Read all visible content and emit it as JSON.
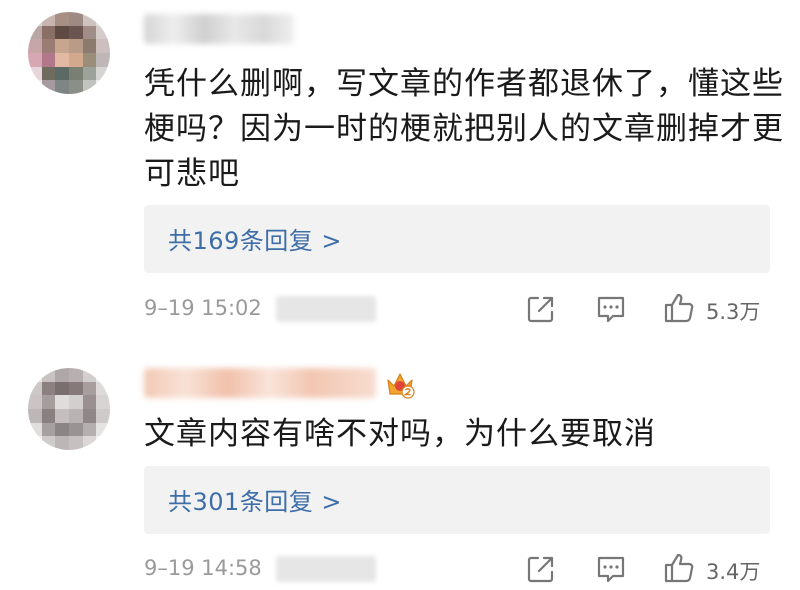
{
  "comments": [
    {
      "text_lines": [
        "凭什么删啊，写文章的作者都退休了，懂这些",
        "梗吗？因为一时的梗就把别人的文章删掉才更",
        "可悲吧"
      ],
      "replies_label": "共169条回复 >",
      "timestamp": "9–19 15:02",
      "like_count": "5.3万"
    },
    {
      "text_lines": [
        "文章内容有啥不对吗，为什么要取消"
      ],
      "replies_label": "共301条回复 >",
      "timestamp": "9–19 14:58",
      "like_count": "3.4万"
    }
  ],
  "icons": {
    "share": "share-icon",
    "comment": "comment-icon",
    "like": "thumbs-up-icon",
    "badge": "crown-badge-icon"
  },
  "colors": {
    "link": "#3d6ea8",
    "meta": "#9a9a9a",
    "reply_bg": "#f2f2f2"
  }
}
